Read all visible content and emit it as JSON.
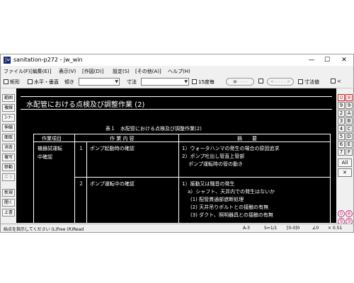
{
  "window": {
    "title": "sanitation-p272 - jw_win",
    "icon_text": "jw",
    "controls": {
      "minimize": "—",
      "maximize": "☐",
      "close": "✕"
    }
  },
  "menu": [
    "ファイル(F)",
    "[編集(E)]",
    "表示(V)",
    "[作図(D)]",
    "設定(S)",
    "[その他(A)]",
    "ヘルプ(H)"
  ],
  "toolbar": {
    "rect_label": "矩形",
    "hv_label": "水平・垂直",
    "tilt_label": "傾き",
    "tilt_value": "",
    "dim_label": "寸法",
    "dim_value": "",
    "deg15_label": "15度毎",
    "pill1": "●- - - -",
    "pill2": "< - - - - >",
    "dimvalue_label": "寸法値",
    "last_label": "<"
  },
  "left_tools": [
    {
      "label": "範囲",
      "enabled": true
    },
    {
      "label": "複線",
      "enabled": true
    },
    {
      "label": "ｺｰﾅｰ",
      "enabled": true
    },
    {
      "label": "伸縮",
      "enabled": true
    },
    {
      "label": "面取",
      "enabled": true
    },
    {
      "label": "消去",
      "enabled": true
    },
    {
      "label": "複写",
      "enabled": true
    },
    {
      "label": "移動",
      "enabled": true
    },
    {
      "label": "戻る",
      "enabled": false
    },
    {
      "label": "新規",
      "enabled": true
    },
    {
      "label": "開く",
      "enabled": true
    },
    {
      "label": "上書",
      "enabled": true
    }
  ],
  "right_tools": {
    "left_col": [
      "0",
      "2",
      "4",
      "6",
      "8",
      "A",
      "C",
      "E"
    ],
    "right_col": [
      "8",
      "9",
      "3",
      "5",
      "7",
      "9",
      "B",
      "D",
      "F"
    ],
    "all_label": "All",
    "x_label": "✕",
    "bottom_left": [
      "0",
      "2"
    ],
    "bottom_right": [
      "8",
      "9"
    ]
  },
  "drawing": {
    "heading": "水配管における点検及び調整作業 (2)",
    "table_caption": "表１　水配管における点検及び調整作業(2)",
    "headers": {
      "col1": "作業項目",
      "col2": "作 業 内 容",
      "col3": "摘　　要"
    },
    "item": [
      "機器試運転",
      "中確認"
    ],
    "rows": [
      {
        "num": "１",
        "content": "ポンプ起動時の確認",
        "notes": [
          "1）ウォータハンマの発生の場合の原因追求",
          "2）ポンプ吐出し管直上管部",
          "　 ポンプ運転時の管の動き"
        ]
      },
      {
        "num": "２",
        "content": "ポンプ運転中の確認",
        "notes": [
          "1）振動又は騒音の発生",
          "a）シャフト、天井内での発生はないか",
          "(1) 配管貫通部遮断処理",
          "(2) 天井吊りボルトとの接触の有無",
          "(3) ダクト、照明器具との接触の有無"
        ]
      }
    ]
  },
  "status": {
    "message": "始点を指示してください (L)free (R)Read",
    "paper": "A-3",
    "scale": "S=1/1",
    "layer": "[0-0]0",
    "angle": "∠0",
    "zoom": "× 0.51"
  }
}
